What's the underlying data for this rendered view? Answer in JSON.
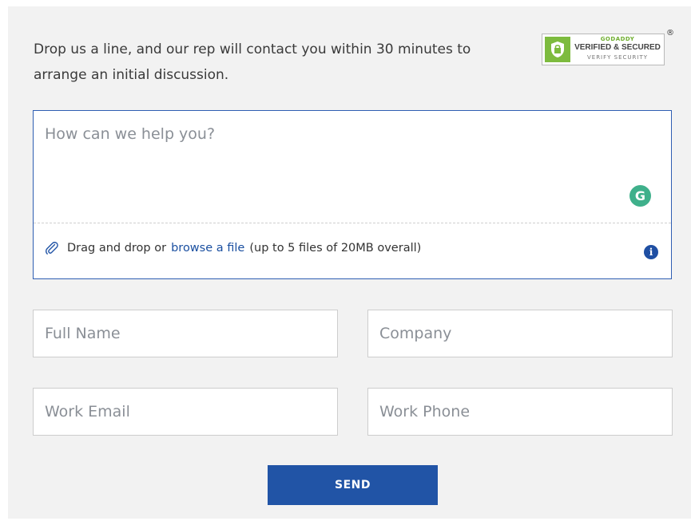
{
  "intro": {
    "text": "Drop us a line, and our rep will contact you within 30 minutes to arrange an initial discussion."
  },
  "badge": {
    "brand": "GODADDY",
    "title": "VERIFIED & SECURED",
    "subtitle": "VERIFY SECURITY",
    "registered": "®",
    "icon": "lock-icon",
    "color": "#7dbb3e"
  },
  "message": {
    "placeholder": "How can we help you?"
  },
  "attach": {
    "prefix": "Drag and drop or",
    "link": "browse a file",
    "suffix": "(up to 5 files of 20MB overall)",
    "info_glyph": "i",
    "grammarly_glyph": "G"
  },
  "form": {
    "full_name_placeholder": "Full Name",
    "company_placeholder": "Company",
    "work_email_placeholder": "Work Email",
    "work_phone_placeholder": "Work Phone",
    "send_label": "SEND"
  },
  "colors": {
    "accent": "#2154a6",
    "border_focus": "#2f5eb2",
    "grammarly": "#3fb08b"
  }
}
